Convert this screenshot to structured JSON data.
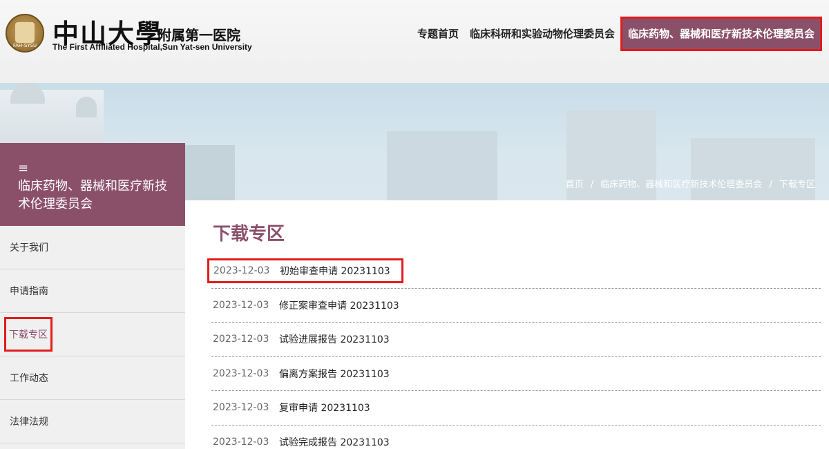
{
  "header": {
    "logo_title": "中山大學",
    "logo_subtitle": "附属第一医院",
    "logo_en": "The First Affiliated Hospital,Sun Yat-sen University",
    "seal_text": "FAH-SYSU",
    "nav": [
      {
        "label": "专题首页"
      },
      {
        "label": "临床科研和实验动物伦理委员会"
      },
      {
        "label": "临床药物、器械和医疗新技术伦理委员会",
        "active": true
      }
    ]
  },
  "breadcrumb": {
    "items": [
      "首页",
      "临床药物、器械和医疗新技术伦理委员会",
      "下载专区"
    ],
    "separator": "/"
  },
  "sidebar": {
    "menu_icon": "menu-icon",
    "title": "临床药物、器械和医疗新技术伦理委员会",
    "items": [
      {
        "label": "关于我们"
      },
      {
        "label": "申请指南"
      },
      {
        "label": "下载专区",
        "active": true
      },
      {
        "label": "工作动态"
      },
      {
        "label": "法律法规"
      }
    ]
  },
  "main": {
    "title": "下载专区",
    "items": [
      {
        "date": "2023-12-03",
        "title": "初始审查申请 20231103"
      },
      {
        "date": "2023-12-03",
        "title": "修正案审查申请 20231103"
      },
      {
        "date": "2023-12-03",
        "title": "试验进展报告 20231103"
      },
      {
        "date": "2023-12-03",
        "title": "偏离方案报告 20231103"
      },
      {
        "date": "2023-12-03",
        "title": "复审申请 20231103"
      },
      {
        "date": "2023-12-03",
        "title": "试验完成报告 20231103"
      }
    ]
  },
  "colors": {
    "brand": "#8b5069",
    "highlight_box": "#e21b1b"
  }
}
